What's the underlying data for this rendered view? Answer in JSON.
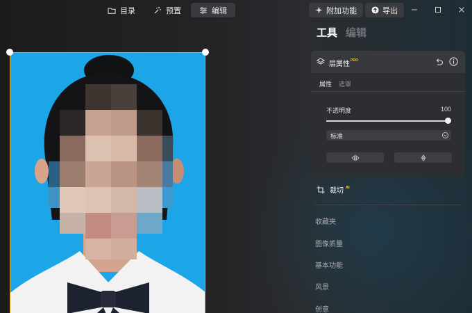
{
  "topbar": {
    "tabs": [
      {
        "label": "目录",
        "icon": "folder-icon"
      },
      {
        "label": "预置",
        "icon": "magic-wand-icon"
      },
      {
        "label": "编辑",
        "icon": "sliders-icon"
      }
    ],
    "active_tab": "编辑",
    "addons_label": "附加功能",
    "export_label": "导出"
  },
  "panel": {
    "tabs": [
      {
        "label": "工具"
      },
      {
        "label": "编辑"
      }
    ],
    "layer": {
      "title": "层属性",
      "badge": "PRO",
      "subtabs": [
        {
          "label": "属性"
        },
        {
          "label": "遮罩"
        }
      ],
      "opacity_label": "不透明度",
      "opacity_value": "100",
      "opacity_level": 1.0,
      "blend_mode": "标准"
    },
    "crop": {
      "label": "裁切",
      "badge": "AI"
    },
    "sections": [
      {
        "label": "收藏夹"
      },
      {
        "label": "图像质量"
      },
      {
        "label": "基本功能"
      },
      {
        "label": "风景"
      },
      {
        "label": "创意"
      }
    ]
  },
  "colors": {
    "photo_background": "#1ca6e8",
    "selection_border": "#e3a22a",
    "badge_gold": "#f2c23c"
  }
}
